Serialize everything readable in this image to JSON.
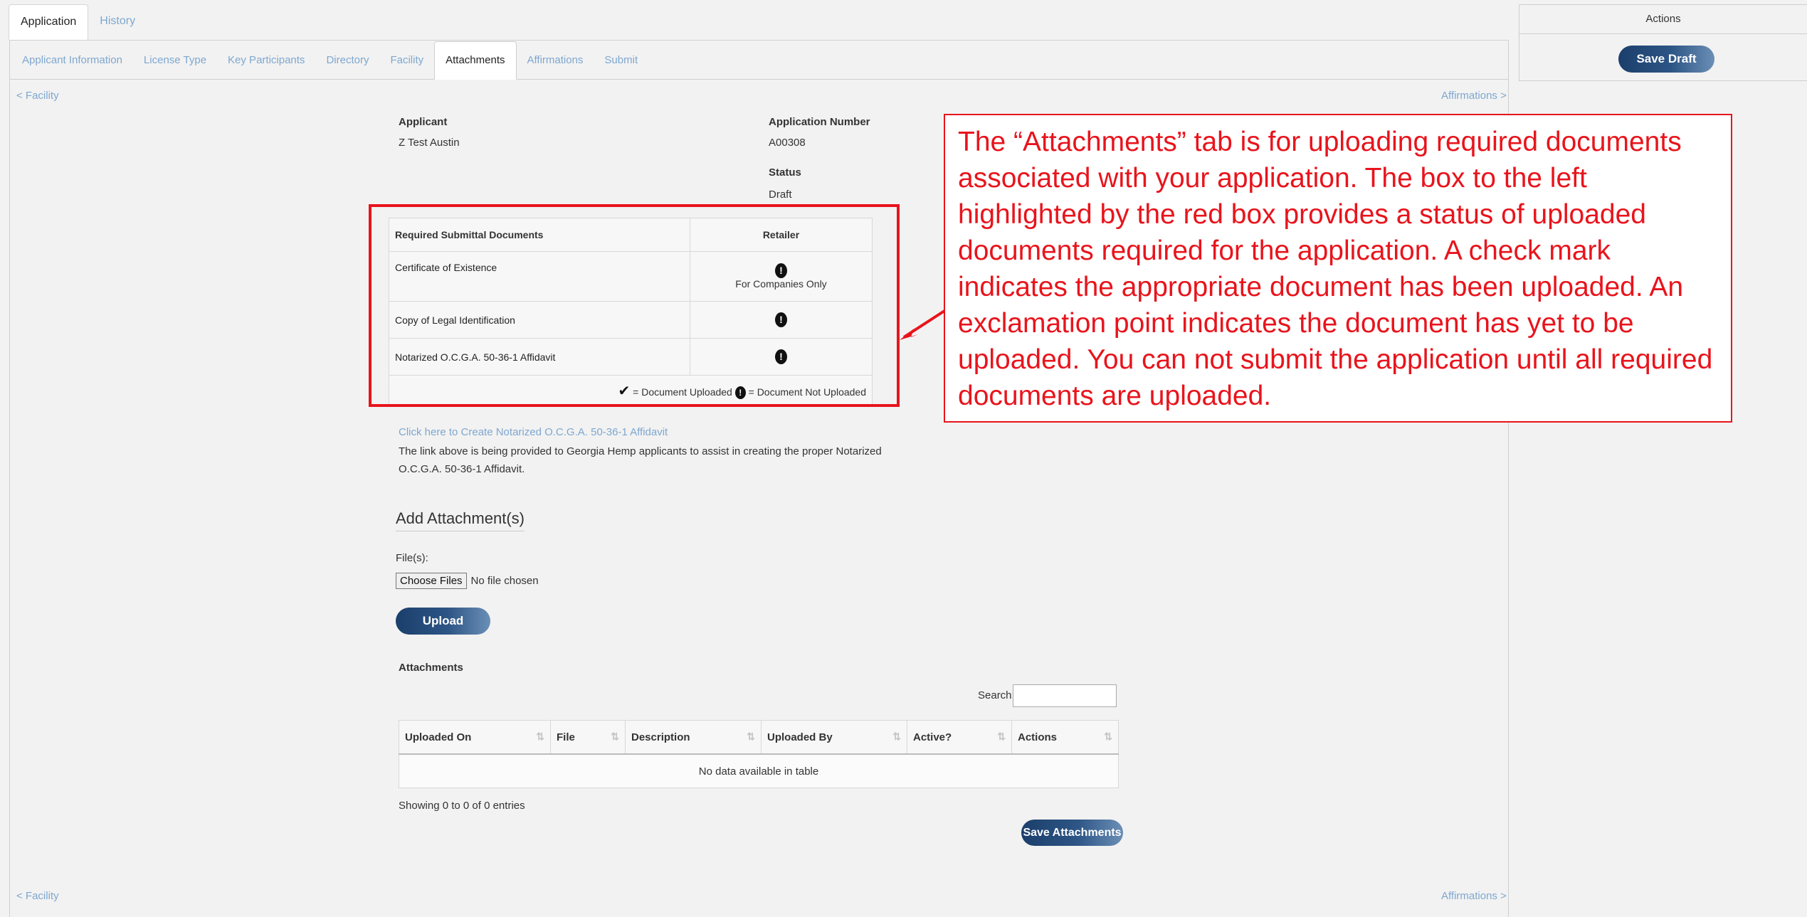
{
  "top_tabs": [
    "Application",
    "History"
  ],
  "sub_tabs": [
    "Applicant Information",
    "License Type",
    "Key Participants",
    "Directory",
    "Facility",
    "Attachments",
    "Affirmations",
    "Submit"
  ],
  "active_sub_tab": "Attachments",
  "nav": {
    "prev": "< Facility",
    "next": "Affirmations >"
  },
  "applicant": {
    "label": "Applicant",
    "value": "Z Test Austin"
  },
  "application_number": {
    "label": "Application Number",
    "value": "A00308"
  },
  "status": {
    "label": "Status",
    "value": "Draft"
  },
  "required_docs": {
    "col_documents": "Required Submittal Documents",
    "col_retailer": "Retailer",
    "rows": [
      {
        "name": "Certificate of Existence",
        "note": "For Companies Only"
      },
      {
        "name": "Copy of Legal Identification",
        "note": ""
      },
      {
        "name": "Notarized O.C.G.A. 50-36-1 Affidavit",
        "note": ""
      }
    ],
    "legend_uploaded": "= Document Uploaded",
    "legend_not_uploaded": "= Document Not Uploaded"
  },
  "affidavit_link": "Click here to Create Notarized O.C.G.A. 50-36-1 Affidavit",
  "affidavit_note": "The link above is being provided to Georgia Hemp applicants to assist in creating the proper Notarized O.C.G.A. 50-36-1 Affidavit.",
  "add_attachment": {
    "title": "Add Attachment(s)",
    "files_label": "File(s):",
    "choose_files": "Choose Files",
    "no_file": "No file chosen",
    "upload": "Upload"
  },
  "attachments": {
    "title": "Attachments",
    "search_label": "Search:",
    "search_value": "",
    "columns": [
      "Uploaded On",
      "File",
      "Description",
      "Uploaded By",
      "Active?",
      "Actions"
    ],
    "empty": "No data available in table",
    "showing": "Showing 0 to 0 of 0 entries",
    "save": "Save Attachments"
  },
  "actions": {
    "title": "Actions",
    "save_draft": "Save Draft"
  },
  "callout": "The “Attachments” tab is for uploading required documents associated with your application.  The box to the left highlighted by the red box provides a status of uploaded documents required for the application.  A check mark indicates the appropriate document has been uploaded.  An exclamation point indicates the document has yet to be uploaded.  You can not submit the application until all required documents are uploaded.",
  "colors": {
    "link": "#7ea7cf",
    "button": "#1b3f6c",
    "annotation": "#e8141c"
  }
}
